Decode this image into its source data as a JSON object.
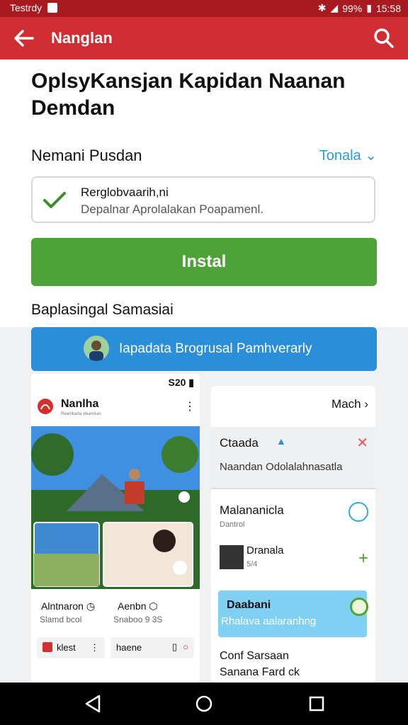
{
  "status_bar": {
    "carrier": "Testrdy",
    "battery": "99%",
    "time": "15:58"
  },
  "app_bar": {
    "title": "Nanglan",
    "back_icon": "arrow-left-icon",
    "search_icon": "search-icon"
  },
  "page": {
    "heading": "OplsyKansjan Kapidan Naanan Demdan",
    "section_label": "Nemani Pusdan",
    "section_action": "Tonala",
    "selected_card": {
      "title": "Rerglobvaarih,ni",
      "subtitle": "Depalnar Aprolalakan Poapamenl."
    },
    "install_button": "Instal",
    "subsection_label": "Baplasingal Samasiai",
    "banner_text": "Iapadata Brogrusal Pamhverarly"
  },
  "phone_preview": {
    "status": "S20",
    "brand": "Nanlha",
    "brand_sub": "Reamkarta vikamiran",
    "captions": [
      {
        "title": "Alntnaron",
        "subtitle": "Slamd bcol"
      },
      {
        "title": "Aenbn",
        "subtitle": "Snaboo 9 3S"
      }
    ],
    "chips": [
      "klest",
      "haene"
    ]
  },
  "side_panel": {
    "menu": "Mach",
    "notification": {
      "title": "Ctaada",
      "subtitle": "Naandan Odolalahnasatla"
    },
    "item1": {
      "title": "Malananicla",
      "subtitle": "Dantrol"
    },
    "item2": {
      "title": "Dranala",
      "subtitle": "5/4"
    },
    "highlight": {
      "title": "Daabani",
      "subtitle": "Rhalava aalaranhng"
    },
    "item4": {
      "title": "Conf Sarsaan",
      "subtitle": "Sanana Fard ck"
    }
  },
  "colors": {
    "app_bar": "#d02d32",
    "install": "#4ea238",
    "banner": "#2a8fd8",
    "link": "#2a9bd4"
  }
}
